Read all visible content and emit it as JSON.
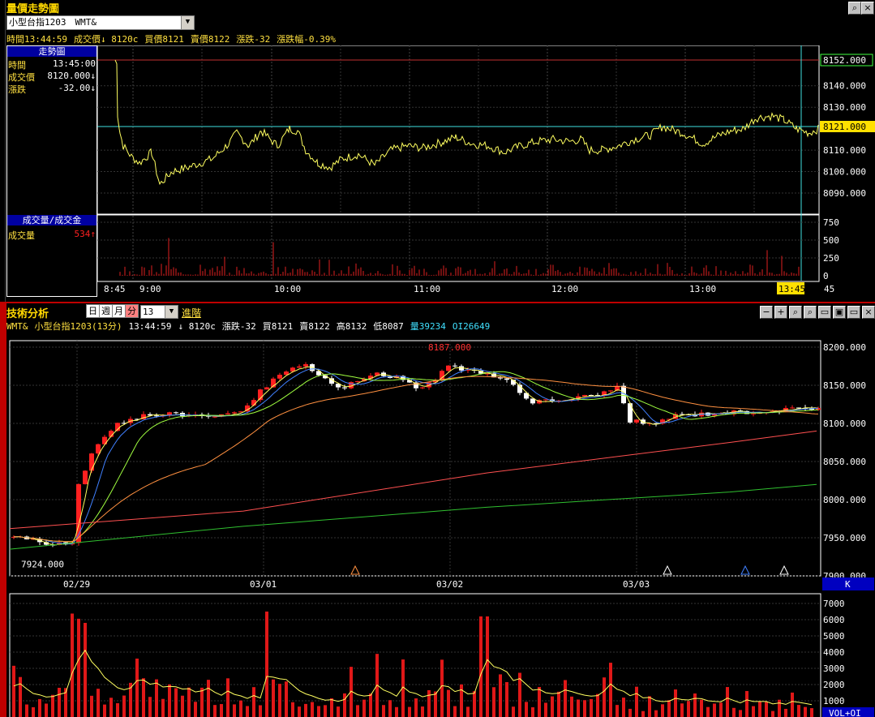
{
  "top": {
    "title": "量價走勢圖",
    "symbol_select": "小型台指1203　WMT&",
    "info_line": [
      {
        "t": "時間13:44:59",
        "c": "#ffe040"
      },
      {
        "t": "成交價↓ 8120c",
        "c": "#ffe040"
      },
      {
        "t": "買價8121",
        "c": "#ffe040"
      },
      {
        "t": "賣價8122",
        "c": "#ffe040"
      },
      {
        "t": "漲跌-32",
        "c": "#ffe040"
      },
      {
        "t": "漲跌幅-0.39%",
        "c": "#ffe040"
      }
    ],
    "trend_header": "走勢圖",
    "rows": [
      {
        "k": "時間",
        "v": "13:45:00"
      },
      {
        "k": "成交價",
        "v": "8120.000↓"
      },
      {
        "k": "漲跌",
        "v": "-32.00↓"
      }
    ],
    "vol_header": "成交量/成交金",
    "vol_row": {
      "k": "成交量",
      "v": "534↑"
    },
    "price_axis": [
      "8152.000",
      "8140.000",
      "8130.000",
      "8121.000",
      "8110.000",
      "8100.000",
      "8090.000"
    ],
    "vol_axis": [
      "750",
      "500",
      "250",
      "0"
    ],
    "time_axis": [
      "8:45",
      "9:00",
      "10:00",
      "11:00",
      "12:00",
      "13:00",
      "13:45",
      "45"
    ]
  },
  "tech": {
    "title": "技術分析",
    "periods": [
      "日",
      "週",
      "月",
      "分"
    ],
    "interval": "13",
    "advanced": "進階",
    "info_line": [
      {
        "t": "WMT&",
        "c": "#ffe040"
      },
      {
        "t": "小型台指1203(13分)",
        "c": "#ffe040"
      },
      {
        "t": "13:44:59",
        "c": "#ffffff"
      },
      {
        "t": "↓ 8120c",
        "c": "#ffffff"
      },
      {
        "t": "漲跌-32",
        "c": "#ffffff"
      },
      {
        "t": "買8121",
        "c": "#ffffff"
      },
      {
        "t": "賣8122",
        "c": "#ffffff"
      },
      {
        "t": "高8132",
        "c": "#ffffff"
      },
      {
        "t": "低8087",
        "c": "#ffffff"
      },
      {
        "t": "量39234",
        "c": "#40e0ff"
      },
      {
        "t": "OI26649",
        "c": "#40e0ff"
      }
    ],
    "price_axis": [
      "8200.000",
      "8150.000",
      "8100.000",
      "8050.000",
      "8000.000",
      "7950.000",
      "7900.000"
    ],
    "date_axis": [
      "02/29",
      "03/01",
      "03/02",
      "03/03"
    ],
    "high_label": "8187.000",
    "low_label": "7924.000",
    "k_label": "K",
    "vol_axis": [
      "7000",
      "6000",
      "5000",
      "4000",
      "3000",
      "2000",
      "1000"
    ],
    "vol_label": "VOL+OI"
  },
  "colors": {
    "up": "#ff2020",
    "down": "#ffffff",
    "price_line": "#ffff60",
    "ref_line": "#40e0e0"
  }
}
